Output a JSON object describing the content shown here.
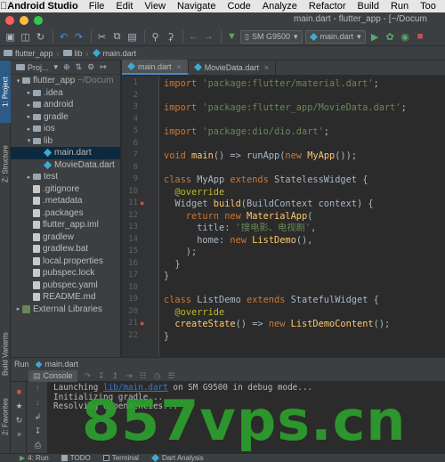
{
  "menubar": {
    "app_name": "Android Studio",
    "menus": [
      "File",
      "Edit",
      "View",
      "Navigate",
      "Code",
      "Analyze",
      "Refactor",
      "Build",
      "Run",
      "Too"
    ]
  },
  "window": {
    "title": "main.dart - flutter_app - [~/Docum"
  },
  "toolbar": {
    "device_combo": "SM G9500",
    "run_config_combo": "main.dart"
  },
  "breadcrumb": [
    "flutter_app",
    "lib",
    "main.dart"
  ],
  "left_stripe": {
    "project_tab": "1: Project",
    "structure_tab": "Z: Structure",
    "build_variants_tab": "Build Variants",
    "favorites_tab": "2: Favorites"
  },
  "project": {
    "header": "Proj...",
    "tree": [
      {
        "label": "flutter_app",
        "suffix": "~/Docum",
        "depth": 0,
        "type": "dir",
        "expanded": true
      },
      {
        "label": ".idea",
        "depth": 1,
        "type": "dir",
        "expanded": false
      },
      {
        "label": "android",
        "depth": 1,
        "type": "dir",
        "expanded": false
      },
      {
        "label": "gradle",
        "depth": 1,
        "type": "dir",
        "expanded": false
      },
      {
        "label": "ios",
        "depth": 1,
        "type": "dir",
        "expanded": false
      },
      {
        "label": "lib",
        "depth": 1,
        "type": "dir",
        "expanded": true
      },
      {
        "label": "main.dart",
        "depth": 2,
        "type": "dart",
        "selected": true
      },
      {
        "label": "MovieData.dart",
        "depth": 2,
        "type": "dart"
      },
      {
        "label": "test",
        "depth": 1,
        "type": "dir",
        "expanded": false
      },
      {
        "label": ".gitignore",
        "depth": 1,
        "type": "file"
      },
      {
        "label": ".metadata",
        "depth": 1,
        "type": "file"
      },
      {
        "label": ".packages",
        "depth": 1,
        "type": "file"
      },
      {
        "label": "flutter_app.iml",
        "depth": 1,
        "type": "file"
      },
      {
        "label": "gradlew",
        "depth": 1,
        "type": "file"
      },
      {
        "label": "gradlew.bat",
        "depth": 1,
        "type": "file"
      },
      {
        "label": "local.properties",
        "depth": 1,
        "type": "file"
      },
      {
        "label": "pubspec.lock",
        "depth": 1,
        "type": "file"
      },
      {
        "label": "pubspec.yaml",
        "depth": 1,
        "type": "file"
      },
      {
        "label": "README.md",
        "depth": 1,
        "type": "file"
      },
      {
        "label": "External Libraries",
        "depth": 0,
        "type": "lib",
        "expanded": false
      }
    ]
  },
  "editor": {
    "tabs": [
      {
        "label": "main.dart",
        "active": true
      },
      {
        "label": "MovieData.dart",
        "active": false
      }
    ],
    "lines": [
      {
        "n": "1",
        "tokens": [
          [
            "kw",
            "import "
          ],
          [
            "str",
            "'package:flutter/material.dart'"
          ],
          [
            "",
            "; "
          ]
        ]
      },
      {
        "n": "2",
        "tokens": []
      },
      {
        "n": "3",
        "tokens": [
          [
            "kw",
            "import "
          ],
          [
            "str",
            "'package:flutter_app/MovieData.dart'"
          ],
          [
            "",
            ";"
          ]
        ]
      },
      {
        "n": "4",
        "tokens": []
      },
      {
        "n": "5",
        "tokens": [
          [
            "kw",
            "import "
          ],
          [
            "str",
            "'package:dio/dio.dart'"
          ],
          [
            "",
            ";"
          ]
        ]
      },
      {
        "n": "6",
        "tokens": []
      },
      {
        "n": "7",
        "tokens": [
          [
            "kw",
            "void "
          ],
          [
            "fn",
            "main"
          ],
          [
            "",
            "() => runApp("
          ],
          [
            "kw",
            "new "
          ],
          [
            "fn",
            "MyApp"
          ],
          [
            "",
            "());"
          ]
        ]
      },
      {
        "n": "8",
        "tokens": []
      },
      {
        "n": "9",
        "tokens": [
          [
            "kw",
            "class "
          ],
          [
            "",
            "MyApp "
          ],
          [
            "kw",
            "extends "
          ],
          [
            "",
            "StatelessWidget {"
          ]
        ]
      },
      {
        "n": "10",
        "tokens": [
          [
            "ann",
            "  @override"
          ]
        ]
      },
      {
        "n": "11",
        "tokens": [
          [
            "",
            "  Widget "
          ],
          [
            "fn",
            "build"
          ],
          [
            "",
            "(BuildContext context) {"
          ]
        ]
      },
      {
        "n": "12",
        "tokens": [
          [
            "kw",
            "    return new "
          ],
          [
            "fn",
            "MaterialApp"
          ],
          [
            "",
            "("
          ]
        ]
      },
      {
        "n": "13",
        "tokens": [
          [
            "",
            "      title: "
          ],
          [
            "str",
            "'搜电影、电视剧'"
          ],
          [
            "",
            ","
          ]
        ]
      },
      {
        "n": "14",
        "tokens": [
          [
            "",
            "      home: "
          ],
          [
            "kw",
            "new "
          ],
          [
            "fn",
            "ListDemo"
          ],
          [
            "",
            "(),"
          ]
        ]
      },
      {
        "n": "15",
        "tokens": [
          [
            "",
            "    );"
          ]
        ]
      },
      {
        "n": "16",
        "tokens": [
          [
            "",
            "  }"
          ]
        ]
      },
      {
        "n": "17",
        "tokens": [
          [
            "",
            "}"
          ]
        ]
      },
      {
        "n": "18",
        "tokens": []
      },
      {
        "n": "19",
        "tokens": [
          [
            "kw",
            "class "
          ],
          [
            "",
            "ListDemo "
          ],
          [
            "kw",
            "extends "
          ],
          [
            "",
            "StatefulWidget {"
          ]
        ]
      },
      {
        "n": "20",
        "tokens": [
          [
            "ann",
            "  @override"
          ]
        ]
      },
      {
        "n": "21",
        "tokens": [
          [
            "",
            "  "
          ],
          [
            "fn",
            "createState"
          ],
          [
            "",
            "() => "
          ],
          [
            "kw",
            "new "
          ],
          [
            "fn",
            "ListDemoContent"
          ],
          [
            "",
            "();"
          ]
        ]
      },
      {
        "n": "22",
        "tokens": [
          [
            "",
            "}"
          ]
        ]
      }
    ]
  },
  "run": {
    "header_label": "Run",
    "config": "main.dart",
    "console_tab": "Console",
    "console_lines": [
      {
        "before": "Launching ",
        "link": "lib/main.dart",
        "after": " on SM G9500 in debug mode..."
      },
      {
        "before": "Initializing gradle...",
        "link": "",
        "after": ""
      },
      {
        "before": "Resolving dependencies...",
        "link": "",
        "after": ""
      }
    ]
  },
  "statusbar": {
    "tabs": [
      "4: Run",
      "TODO",
      "Terminal",
      "Dart Analysis"
    ]
  },
  "watermark": "857vps.cn",
  "colors": {
    "keyword": "#cc7832",
    "string": "#6a8759",
    "annotation": "#bbb529",
    "function": "#ffc66d",
    "watermark": "#2e9e2e",
    "selection": "#0d293e"
  }
}
